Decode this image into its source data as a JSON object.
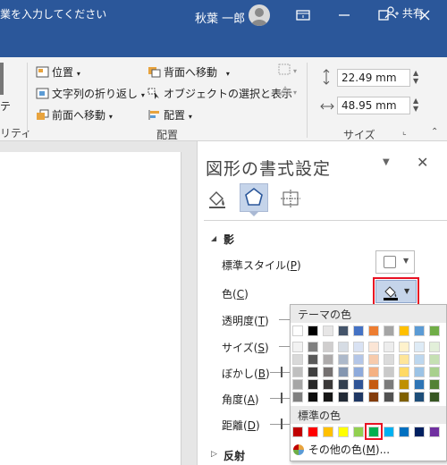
{
  "window": {
    "user_name": "秋葉 一郎",
    "tell_me_text": "業を入力してください",
    "share_label": "共有"
  },
  "ribbon": {
    "position_label": "位置",
    "wrap_label": "文字列の折り返し",
    "bring_forward_label": "前面へ移動",
    "send_backward_label": "背面へ移動",
    "selection_pane_label": "オブジェクトの選択と表示",
    "align_label": "配置",
    "group_arrange": "配置",
    "group_size": "サイズ",
    "height_value": "22.49 mm",
    "width_value": "48.95 mm",
    "left_cut_1": "テ",
    "left_cut_2": "リティ"
  },
  "pane": {
    "title": "図形の書式設定",
    "section_shadow": "影",
    "section_reflection": "反射",
    "rows": {
      "preset": {
        "text": "標準スタイル",
        "key": "P"
      },
      "color": {
        "text": "色",
        "key": "C"
      },
      "transparency": {
        "text": "透明度",
        "key": "T"
      },
      "size": {
        "text": "サイズ",
        "key": "S"
      },
      "blur": {
        "text": "ぼかし",
        "key": "B"
      },
      "angle": {
        "text": "角度",
        "key": "A"
      },
      "distance": {
        "text": "距離",
        "key": "D"
      }
    }
  },
  "color_menu": {
    "theme_colors_label": "テーマの色",
    "standard_colors_label": "標準の色",
    "more_colors": {
      "text": "その他の色",
      "key": "M",
      "suffix": "..."
    },
    "theme_colors": [
      [
        "#ffffff",
        "#f2f2f2",
        "#d9d9d9",
        "#bfbfbf",
        "#a6a6a6",
        "#808080"
      ],
      [
        "#000000",
        "#808080",
        "#595959",
        "#404040",
        "#262626",
        "#0d0d0d"
      ],
      [
        "#e7e6e6",
        "#d0cece",
        "#aeabab",
        "#757171",
        "#3a3838",
        "#161616"
      ],
      [
        "#44546a",
        "#d6dce4",
        "#adb9ca",
        "#8496b0",
        "#333f4f",
        "#222a35"
      ],
      [
        "#4472c4",
        "#d9e2f3",
        "#b4c6e7",
        "#8eaadb",
        "#2f5496",
        "#1f3864"
      ],
      [
        "#ed7d31",
        "#fbe5d5",
        "#f7cbac",
        "#f4b183",
        "#c55a11",
        "#833c0b"
      ],
      [
        "#a5a5a5",
        "#ededed",
        "#dbdbdb",
        "#c9c9c9",
        "#7b7b7b",
        "#525252"
      ],
      [
        "#ffc000",
        "#fff2cc",
        "#fee599",
        "#ffd965",
        "#bf9000",
        "#7f6000"
      ],
      [
        "#5b9bd5",
        "#deebf6",
        "#bdd7ee",
        "#9cc3e5",
        "#2e75b5",
        "#1e4e79"
      ],
      [
        "#70ad47",
        "#e2efd9",
        "#c5e0b3",
        "#a8d08d",
        "#538135",
        "#375623"
      ]
    ],
    "standard_colors": [
      "#c00000",
      "#ff0000",
      "#ffc000",
      "#ffff00",
      "#92d050",
      "#00b050",
      "#00b0f0",
      "#0070c0",
      "#002060",
      "#7030a0"
    ],
    "selected_standard_index": 5
  },
  "colors": {
    "title_bar": "#2b579a",
    "highlight": "#e81123",
    "selected_icon_bg": "#c5d4ea"
  }
}
